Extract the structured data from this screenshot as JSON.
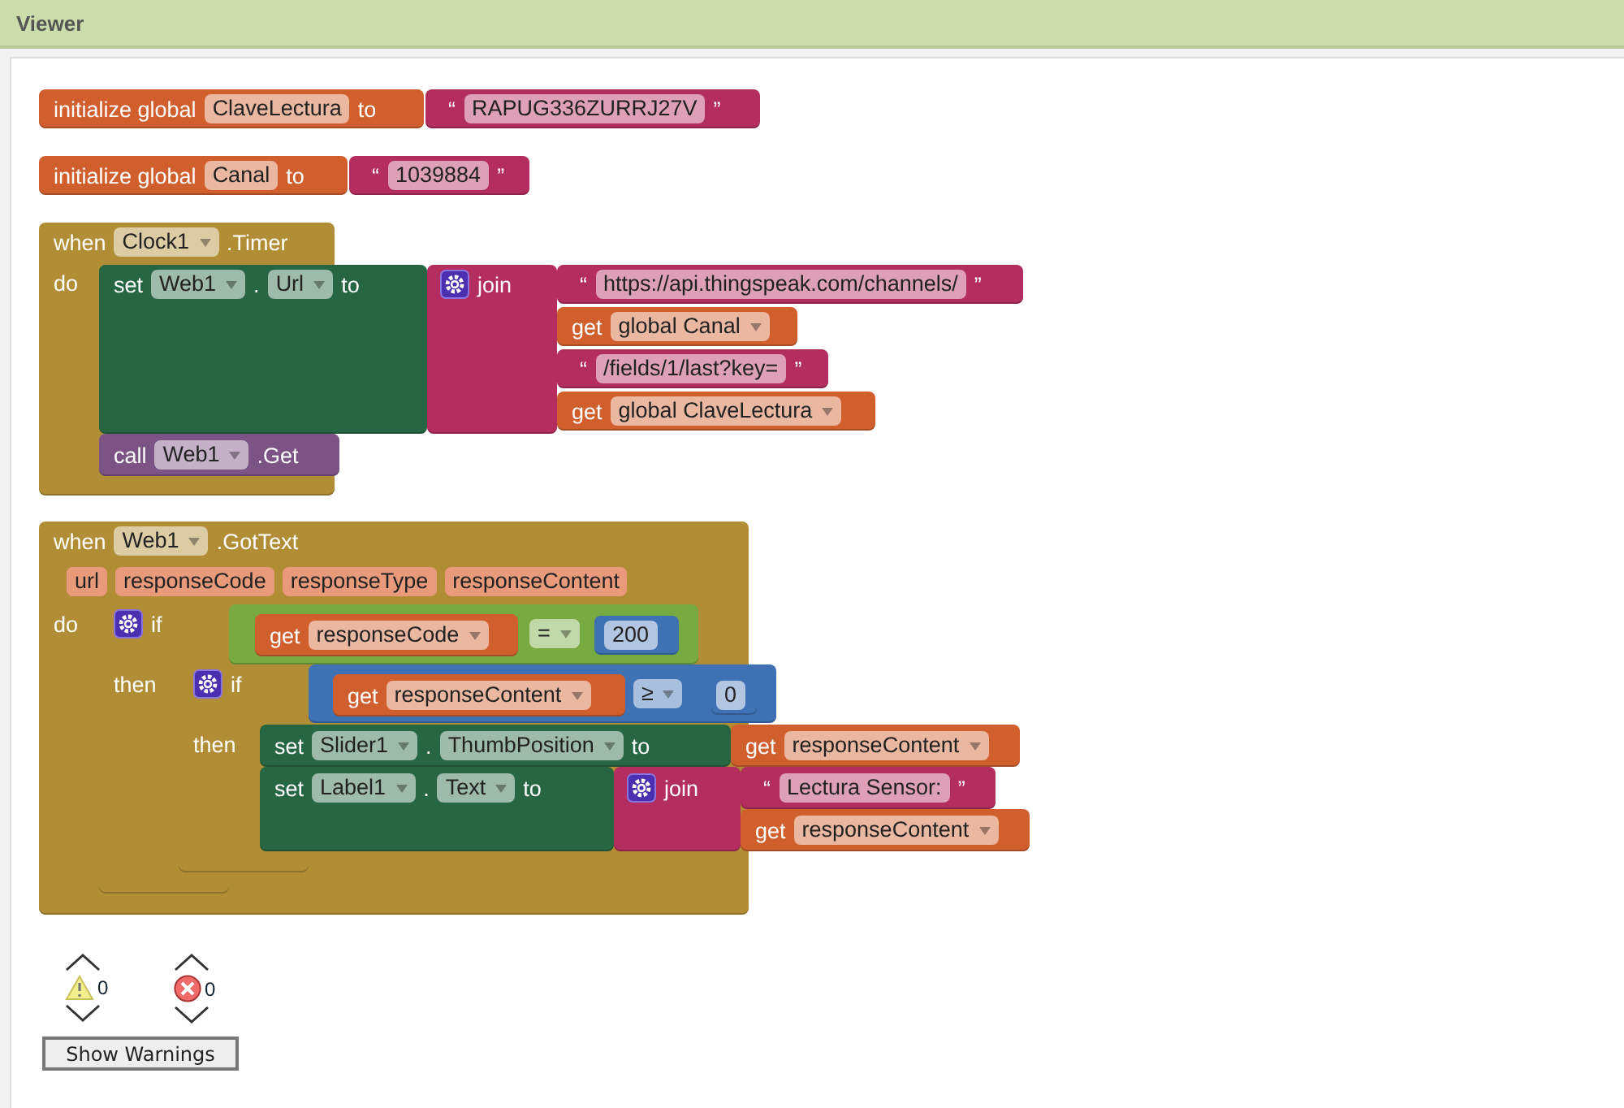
{
  "header": {
    "title": "Viewer"
  },
  "blocks": [
    {
      "kind": "init",
      "rows": [
        [
          {
            "kind": "label",
            "text": "initialize global"
          },
          {
            "kind": "field",
            "text": "ClaveLectura"
          },
          {
            "kind": "label",
            "text": "to"
          }
        ]
      ],
      "children": [
        {
          "kind": "string",
          "rows": [
            [
              {
                "kind": "label",
                "text": "“"
              },
              {
                "kind": "field",
                "text": "RAPUG336ZURRJ27V"
              },
              {
                "kind": "label",
                "text": "”"
              }
            ]
          ]
        }
      ]
    },
    {
      "kind": "init",
      "rows": [
        [
          {
            "kind": "label",
            "text": "initialize global"
          },
          {
            "kind": "field",
            "text": "Canal"
          },
          {
            "kind": "label",
            "text": "to"
          }
        ]
      ],
      "children": [
        {
          "kind": "string",
          "rows": [
            [
              {
                "kind": "label",
                "text": "“"
              },
              {
                "kind": "field",
                "text": "1039884"
              },
              {
                "kind": "label",
                "text": "”"
              }
            ]
          ]
        }
      ]
    },
    {
      "kind": "event",
      "rows": [
        [
          {
            "kind": "label",
            "text": "when"
          },
          {
            "kind": "dropdown",
            "text": "Clock1"
          },
          {
            "kind": "label",
            "text": ".Timer"
          }
        ],
        [
          {
            "kind": "label",
            "text": "do"
          }
        ]
      ],
      "children": [
        {
          "kind": "setter",
          "rows": [
            [
              {
                "kind": "label",
                "text": "set"
              },
              {
                "kind": "dropdown",
                "text": "Web1"
              },
              {
                "kind": "label",
                "text": "."
              },
              {
                "kind": "dropdown",
                "text": "Url"
              },
              {
                "kind": "label",
                "text": "to"
              }
            ]
          ],
          "children": [
            {
              "kind": "join",
              "rows": [
                [
                  {
                    "kind": "gear"
                  },
                  {
                    "kind": "label",
                    "text": "join"
                  }
                ]
              ],
              "children": [
                {
                  "kind": "string",
                  "rows": [
                    [
                      {
                        "kind": "label",
                        "text": "“"
                      },
                      {
                        "kind": "field",
                        "text": "https://api.thingspeak.com/channels/"
                      },
                      {
                        "kind": "label",
                        "text": "”"
                      }
                    ]
                  ]
                },
                {
                  "kind": "getter",
                  "rows": [
                    [
                      {
                        "kind": "label",
                        "text": "get"
                      },
                      {
                        "kind": "dropdown",
                        "text": "global Canal"
                      }
                    ]
                  ]
                },
                {
                  "kind": "string",
                  "rows": [
                    [
                      {
                        "kind": "label",
                        "text": "“"
                      },
                      {
                        "kind": "field",
                        "text": "/fields/1/last?key="
                      },
                      {
                        "kind": "label",
                        "text": "”"
                      }
                    ]
                  ]
                },
                {
                  "kind": "getter",
                  "rows": [
                    [
                      {
                        "kind": "label",
                        "text": "get"
                      },
                      {
                        "kind": "dropdown",
                        "text": "global ClaveLectura"
                      }
                    ]
                  ]
                }
              ]
            }
          ]
        },
        {
          "kind": "call",
          "rows": [
            [
              {
                "kind": "label",
                "text": "call"
              },
              {
                "kind": "dropdown",
                "text": "Web1"
              },
              {
                "kind": "label",
                "text": ".Get"
              }
            ]
          ]
        }
      ]
    },
    {
      "kind": "event",
      "rows": [
        [
          {
            "kind": "label",
            "text": "when"
          },
          {
            "kind": "dropdown",
            "text": "Web1"
          },
          {
            "kind": "label",
            "text": ".GotText"
          }
        ],
        [
          {
            "kind": "param",
            "text": "url"
          },
          {
            "kind": "param",
            "text": "responseCode"
          },
          {
            "kind": "param",
            "text": "responseType"
          },
          {
            "kind": "param",
            "text": "responseContent"
          }
        ],
        [
          {
            "kind": "label",
            "text": "do"
          }
        ]
      ],
      "children": [
        {
          "kind": "if",
          "rows": [
            [
              {
                "kind": "gear"
              },
              {
                "kind": "label",
                "text": "if"
              }
            ],
            [
              {
                "kind": "label",
                "text": "then"
              }
            ]
          ],
          "children": [
            {
              "kind": "logic_compare",
              "rows": [
                [
                  {
                    "kind": "dropdown",
                    "text": "="
                  }
                ]
              ],
              "children": [
                {
                  "kind": "getter",
                  "rows": [
                    [
                      {
                        "kind": "label",
                        "text": "get"
                      },
                      {
                        "kind": "dropdown",
                        "text": "responseCode"
                      }
                    ]
                  ]
                },
                {
                  "kind": "number",
                  "rows": [
                    [
                      {
                        "kind": "field",
                        "text": "200"
                      }
                    ]
                  ]
                }
              ]
            },
            {
              "kind": "if",
              "rows": [
                [
                  {
                    "kind": "gear"
                  },
                  {
                    "kind": "label",
                    "text": "if"
                  }
                ],
                [
                  {
                    "kind": "label",
                    "text": "then"
                  }
                ]
              ],
              "children": [
                {
                  "kind": "math_compare",
                  "rows": [
                    [
                      {
                        "kind": "dropdown",
                        "text": "≥"
                      }
                    ]
                  ],
                  "children": [
                    {
                      "kind": "getter",
                      "rows": [
                        [
                          {
                            "kind": "label",
                            "text": "get"
                          },
                          {
                            "kind": "dropdown",
                            "text": "responseContent"
                          }
                        ]
                      ]
                    },
                    {
                      "kind": "number",
                      "rows": [
                        [
                          {
                            "kind": "field",
                            "text": "0"
                          }
                        ]
                      ]
                    }
                  ]
                },
                {
                  "kind": "setter",
                  "rows": [
                    [
                      {
                        "kind": "label",
                        "text": "set"
                      },
                      {
                        "kind": "dropdown",
                        "text": "Slider1"
                      },
                      {
                        "kind": "label",
                        "text": "."
                      },
                      {
                        "kind": "dropdown",
                        "text": "ThumbPosition"
                      },
                      {
                        "kind": "label",
                        "text": "to"
                      }
                    ]
                  ],
                  "children": [
                    {
                      "kind": "getter",
                      "rows": [
                        [
                          {
                            "kind": "label",
                            "text": "get"
                          },
                          {
                            "kind": "dropdown",
                            "text": "responseContent"
                          }
                        ]
                      ]
                    }
                  ]
                },
                {
                  "kind": "setter",
                  "rows": [
                    [
                      {
                        "kind": "label",
                        "text": "set"
                      },
                      {
                        "kind": "dropdown",
                        "text": "Label1"
                      },
                      {
                        "kind": "label",
                        "text": "."
                      },
                      {
                        "kind": "dropdown",
                        "text": "Text"
                      },
                      {
                        "kind": "label",
                        "text": "to"
                      }
                    ]
                  ],
                  "children": [
                    {
                      "kind": "join",
                      "rows": [
                        [
                          {
                            "kind": "gear"
                          },
                          {
                            "kind": "label",
                            "text": "join"
                          }
                        ]
                      ],
                      "children": [
                        {
                          "kind": "string",
                          "rows": [
                            [
                              {
                                "kind": "label",
                                "text": "“"
                              },
                              {
                                "kind": "field",
                                "text": "Lectura Sensor: "
                              },
                              {
                                "kind": "label",
                                "text": "”"
                              }
                            ]
                          ]
                        },
                        {
                          "kind": "getter",
                          "rows": [
                            [
                              {
                                "kind": "label",
                                "text": "get"
                              },
                              {
                                "kind": "dropdown",
                                "text": "responseContent"
                              }
                            ]
                          ]
                        }
                      ]
                    }
                  ]
                }
              ]
            }
          ]
        }
      ]
    }
  ],
  "indicators": {
    "warning_count": "0",
    "error_count": "0",
    "button": "Show Warnings"
  }
}
